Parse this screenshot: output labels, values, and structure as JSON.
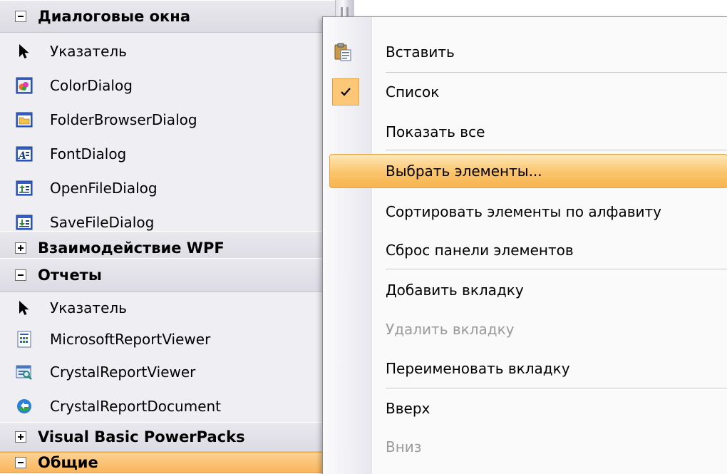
{
  "toolbox": {
    "groups": [
      {
        "title": "Диалоговые окна",
        "state": "expanded"
      },
      {
        "title": "Взаимодействие WPF",
        "state": "collapsed"
      },
      {
        "title": "Отчеты",
        "state": "expanded"
      },
      {
        "title": "Visual Basic PowerPacks",
        "state": "collapsed"
      },
      {
        "title": "Общие",
        "state": "expanded",
        "active": true
      }
    ],
    "dialog_items": [
      {
        "label": "Указатель",
        "icon": "pointer-icon"
      },
      {
        "label": "ColorDialog",
        "icon": "color-dialog-icon"
      },
      {
        "label": "FolderBrowserDialog",
        "icon": "folder-browser-icon"
      },
      {
        "label": "FontDialog",
        "icon": "font-dialog-icon"
      },
      {
        "label": "OpenFileDialog",
        "icon": "open-file-dialog-icon"
      },
      {
        "label": "SaveFileDialog",
        "icon": "save-file-dialog-icon"
      }
    ],
    "report_items": [
      {
        "label": "Указатель",
        "icon": "pointer-icon"
      },
      {
        "label": "MicrosoftReportViewer",
        "icon": "report-viewer-icon"
      },
      {
        "label": "CrystalReportViewer",
        "icon": "crystal-viewer-icon"
      },
      {
        "label": "CrystalReportDocument",
        "icon": "crystal-document-icon"
      }
    ]
  },
  "context_menu": {
    "items": [
      {
        "label": "Вставить",
        "icon": "paste-icon"
      },
      {
        "label": "Список",
        "checked": true
      },
      {
        "label": "Показать все"
      },
      {
        "label": "Выбрать элементы...",
        "hovered": true
      },
      {
        "label": "Сортировать элементы по алфавиту"
      },
      {
        "label": "Сброс панели элементов"
      },
      {
        "label": "Добавить вкладку"
      },
      {
        "label": "Удалить вкладку",
        "disabled": true
      },
      {
        "label": "Переименовать вкладку"
      },
      {
        "label": "Вверх"
      },
      {
        "label": "Вниз",
        "disabled": true
      }
    ]
  },
  "colors": {
    "highlight": "#fbc46b",
    "check_background": "#fcc777",
    "toolbox_background": "#efeef2",
    "disabled_text": "#9a9a9a"
  }
}
